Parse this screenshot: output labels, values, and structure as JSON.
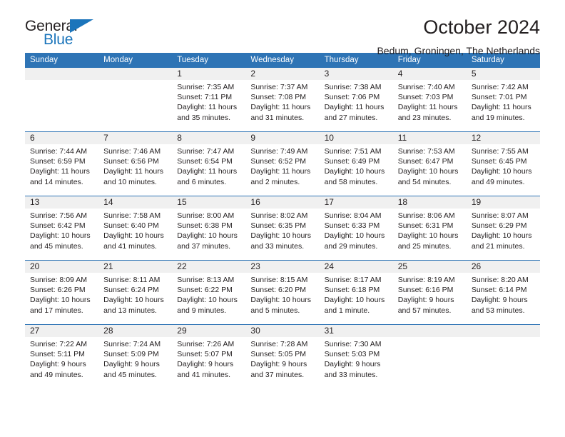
{
  "brand": {
    "logo_word1": "General",
    "logo_word2": "Blue",
    "logo_triangle": "triangle-icon",
    "accent_color": "#1b75bb"
  },
  "header": {
    "title": "October 2024",
    "location": "Bedum, Groningen, The Netherlands"
  },
  "calendar": {
    "header_bg": "#2e74b5",
    "daynum_band_bg": "#f0f0f0",
    "weekdays": [
      "Sunday",
      "Monday",
      "Tuesday",
      "Wednesday",
      "Thursday",
      "Friday",
      "Saturday"
    ],
    "weeks": [
      [
        {
          "day": "",
          "blank": true
        },
        {
          "day": "",
          "blank": true
        },
        {
          "day": "1",
          "sunrise": "Sunrise: 7:35 AM",
          "sunset": "Sunset: 7:11 PM",
          "daylight": "Daylight: 11 hours and 35 minutes."
        },
        {
          "day": "2",
          "sunrise": "Sunrise: 7:37 AM",
          "sunset": "Sunset: 7:08 PM",
          "daylight": "Daylight: 11 hours and 31 minutes."
        },
        {
          "day": "3",
          "sunrise": "Sunrise: 7:38 AM",
          "sunset": "Sunset: 7:06 PM",
          "daylight": "Daylight: 11 hours and 27 minutes."
        },
        {
          "day": "4",
          "sunrise": "Sunrise: 7:40 AM",
          "sunset": "Sunset: 7:03 PM",
          "daylight": "Daylight: 11 hours and 23 minutes."
        },
        {
          "day": "5",
          "sunrise": "Sunrise: 7:42 AM",
          "sunset": "Sunset: 7:01 PM",
          "daylight": "Daylight: 11 hours and 19 minutes."
        }
      ],
      [
        {
          "day": "6",
          "sunrise": "Sunrise: 7:44 AM",
          "sunset": "Sunset: 6:59 PM",
          "daylight": "Daylight: 11 hours and 14 minutes."
        },
        {
          "day": "7",
          "sunrise": "Sunrise: 7:46 AM",
          "sunset": "Sunset: 6:56 PM",
          "daylight": "Daylight: 11 hours and 10 minutes."
        },
        {
          "day": "8",
          "sunrise": "Sunrise: 7:47 AM",
          "sunset": "Sunset: 6:54 PM",
          "daylight": "Daylight: 11 hours and 6 minutes."
        },
        {
          "day": "9",
          "sunrise": "Sunrise: 7:49 AM",
          "sunset": "Sunset: 6:52 PM",
          "daylight": "Daylight: 11 hours and 2 minutes."
        },
        {
          "day": "10",
          "sunrise": "Sunrise: 7:51 AM",
          "sunset": "Sunset: 6:49 PM",
          "daylight": "Daylight: 10 hours and 58 minutes."
        },
        {
          "day": "11",
          "sunrise": "Sunrise: 7:53 AM",
          "sunset": "Sunset: 6:47 PM",
          "daylight": "Daylight: 10 hours and 54 minutes."
        },
        {
          "day": "12",
          "sunrise": "Sunrise: 7:55 AM",
          "sunset": "Sunset: 6:45 PM",
          "daylight": "Daylight: 10 hours and 49 minutes."
        }
      ],
      [
        {
          "day": "13",
          "sunrise": "Sunrise: 7:56 AM",
          "sunset": "Sunset: 6:42 PM",
          "daylight": "Daylight: 10 hours and 45 minutes."
        },
        {
          "day": "14",
          "sunrise": "Sunrise: 7:58 AM",
          "sunset": "Sunset: 6:40 PM",
          "daylight": "Daylight: 10 hours and 41 minutes."
        },
        {
          "day": "15",
          "sunrise": "Sunrise: 8:00 AM",
          "sunset": "Sunset: 6:38 PM",
          "daylight": "Daylight: 10 hours and 37 minutes."
        },
        {
          "day": "16",
          "sunrise": "Sunrise: 8:02 AM",
          "sunset": "Sunset: 6:35 PM",
          "daylight": "Daylight: 10 hours and 33 minutes."
        },
        {
          "day": "17",
          "sunrise": "Sunrise: 8:04 AM",
          "sunset": "Sunset: 6:33 PM",
          "daylight": "Daylight: 10 hours and 29 minutes."
        },
        {
          "day": "18",
          "sunrise": "Sunrise: 8:06 AM",
          "sunset": "Sunset: 6:31 PM",
          "daylight": "Daylight: 10 hours and 25 minutes."
        },
        {
          "day": "19",
          "sunrise": "Sunrise: 8:07 AM",
          "sunset": "Sunset: 6:29 PM",
          "daylight": "Daylight: 10 hours and 21 minutes."
        }
      ],
      [
        {
          "day": "20",
          "sunrise": "Sunrise: 8:09 AM",
          "sunset": "Sunset: 6:26 PM",
          "daylight": "Daylight: 10 hours and 17 minutes."
        },
        {
          "day": "21",
          "sunrise": "Sunrise: 8:11 AM",
          "sunset": "Sunset: 6:24 PM",
          "daylight": "Daylight: 10 hours and 13 minutes."
        },
        {
          "day": "22",
          "sunrise": "Sunrise: 8:13 AM",
          "sunset": "Sunset: 6:22 PM",
          "daylight": "Daylight: 10 hours and 9 minutes."
        },
        {
          "day": "23",
          "sunrise": "Sunrise: 8:15 AM",
          "sunset": "Sunset: 6:20 PM",
          "daylight": "Daylight: 10 hours and 5 minutes."
        },
        {
          "day": "24",
          "sunrise": "Sunrise: 8:17 AM",
          "sunset": "Sunset: 6:18 PM",
          "daylight": "Daylight: 10 hours and 1 minute."
        },
        {
          "day": "25",
          "sunrise": "Sunrise: 8:19 AM",
          "sunset": "Sunset: 6:16 PM",
          "daylight": "Daylight: 9 hours and 57 minutes."
        },
        {
          "day": "26",
          "sunrise": "Sunrise: 8:20 AM",
          "sunset": "Sunset: 6:14 PM",
          "daylight": "Daylight: 9 hours and 53 minutes."
        }
      ],
      [
        {
          "day": "27",
          "sunrise": "Sunrise: 7:22 AM",
          "sunset": "Sunset: 5:11 PM",
          "daylight": "Daylight: 9 hours and 49 minutes."
        },
        {
          "day": "28",
          "sunrise": "Sunrise: 7:24 AM",
          "sunset": "Sunset: 5:09 PM",
          "daylight": "Daylight: 9 hours and 45 minutes."
        },
        {
          "day": "29",
          "sunrise": "Sunrise: 7:26 AM",
          "sunset": "Sunset: 5:07 PM",
          "daylight": "Daylight: 9 hours and 41 minutes."
        },
        {
          "day": "30",
          "sunrise": "Sunrise: 7:28 AM",
          "sunset": "Sunset: 5:05 PM",
          "daylight": "Daylight: 9 hours and 37 minutes."
        },
        {
          "day": "31",
          "sunrise": "Sunrise: 7:30 AM",
          "sunset": "Sunset: 5:03 PM",
          "daylight": "Daylight: 9 hours and 33 minutes."
        },
        {
          "day": "",
          "blank": true
        },
        {
          "day": "",
          "blank": true
        }
      ]
    ]
  }
}
